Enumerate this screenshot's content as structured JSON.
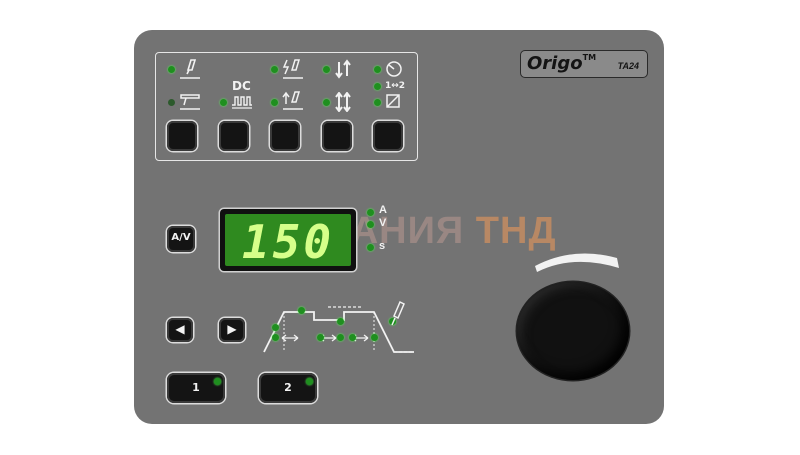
{
  "brand": {
    "name": "Origo",
    "trademark": "TM",
    "model": "TA24"
  },
  "mode_panel": {
    "columns": [
      {
        "top_icon": "tig-torch-icon",
        "bottom_icon": "mma-electrode-icon",
        "bottom_label": ""
      },
      {
        "top_icon": "",
        "bottom_icon": "pulse-icon",
        "bottom_label": "DC"
      },
      {
        "top_icon": "hf-ignition-icon",
        "bottom_icon": "lift-arc-icon",
        "bottom_label": ""
      },
      {
        "top_icon": "2-stroke-icon",
        "bottom_icon": "4-stroke-icon",
        "bottom_label": ""
      },
      {
        "top_icon": "remote-control-icon",
        "middle_label": "1↔2",
        "bottom_icon": "spot-icon"
      }
    ]
  },
  "display": {
    "value": "150"
  },
  "units": {
    "a": "A",
    "v": "V",
    "s": "s"
  },
  "av_button": {
    "label_a": "A",
    "label_v": "V"
  },
  "nav": {
    "left_icon": "left-arrow-icon",
    "right_icon": "right-arrow-icon"
  },
  "memory": [
    {
      "label": "1"
    },
    {
      "label": "2"
    }
  ],
  "watermark": {
    "text_main": "КОМПАНИЯ",
    "text_accent": "ТНД"
  },
  "colors": {
    "panel": "#737373",
    "led": "#1f8f1f",
    "display": "#2f8a1f",
    "digits": "#d6ff8a"
  }
}
